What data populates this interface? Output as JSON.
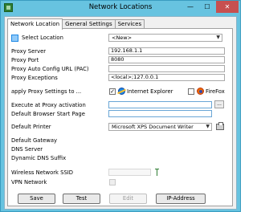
{
  "window": {
    "title": "Network Locations",
    "min_glyph": "—",
    "max_glyph": "☐",
    "close_glyph": "✕"
  },
  "tabs": [
    {
      "label": "Network Location",
      "active": true
    },
    {
      "label": "General Settings",
      "active": false
    },
    {
      "label": "Services",
      "active": false
    }
  ],
  "location": {
    "label": "Select Location",
    "selected": "<New>",
    "icon": "network-location-icon"
  },
  "proxy": {
    "server_label": "Proxy Server",
    "server_value": "192.168.1.1",
    "port_label": "Proxy Port",
    "port_value": "8080",
    "pac_label": "Proxy Auto Config URL (PAC)",
    "pac_value": "",
    "exceptions_label": "Proxy Exceptions",
    "exceptions_value": "<local>;127.0.0.1"
  },
  "apply": {
    "label": "apply Proxy Settings to ...",
    "ie_checked": true,
    "ie_mark": "✓",
    "ie_label": "Internet Explorer",
    "ie_icon": "internet-explorer-icon",
    "ff_checked": false,
    "ff_label": "FireFox",
    "ff_icon": "firefox-icon"
  },
  "activation": {
    "label": "Execute at Proxy activation",
    "value": "",
    "browse_label": "..."
  },
  "start_page": {
    "label": "Default Browser Start Page",
    "value": ""
  },
  "printer": {
    "label": "Default Printer",
    "selected": "Microsoft XPS Document Writer",
    "icon": "printer-icon"
  },
  "network_info": {
    "gateway_label": "Default Gateway",
    "dns_label": "DNS Server",
    "dns_suffix_label": "Dynamic DNS Suffix"
  },
  "wireless": {
    "ssid_label": "Wireless Network SSID",
    "vpn_label": "VPN Network",
    "signal_icon": "wireless-signal-icon"
  },
  "buttons": {
    "save": "Save",
    "test": "Test",
    "edit": "Edit",
    "ip_address": "IP-Address"
  },
  "colors": {
    "titlebar": "#67c3e0",
    "close_button": "#c75050",
    "panel_background": "#ffffff"
  }
}
